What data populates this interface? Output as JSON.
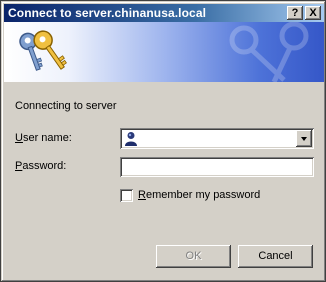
{
  "window": {
    "title": "Connect to server.chinanusa.local",
    "help_label": "?",
    "close_label": "X"
  },
  "banner": {
    "icon": "keys-icon"
  },
  "message": "Connecting to server",
  "form": {
    "username": {
      "label_hotkey": "U",
      "label_rest": "ser name:",
      "value": "",
      "icon": "user-icon"
    },
    "password": {
      "label_hotkey": "P",
      "label_rest": "assword:",
      "value": ""
    },
    "remember": {
      "label_hotkey": "R",
      "label_rest": "emember my password",
      "checked": false
    }
  },
  "buttons": {
    "ok": "OK",
    "cancel": "Cancel"
  },
  "colors": {
    "titlebar_start": "#0a246a",
    "titlebar_end": "#a6caf0",
    "dialog_face": "#d4d0c8"
  }
}
